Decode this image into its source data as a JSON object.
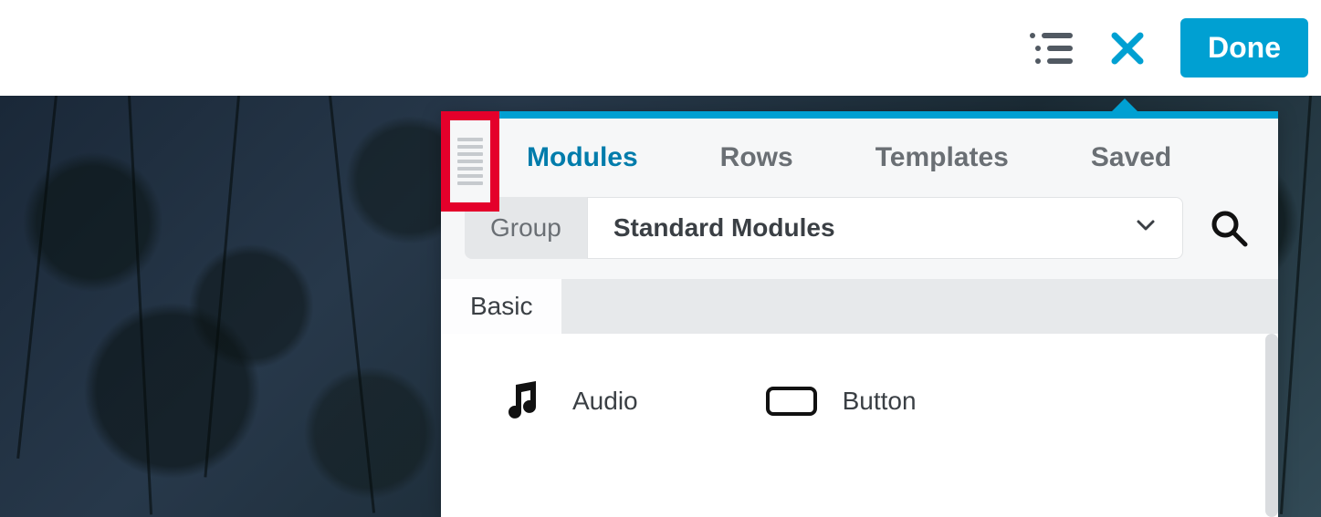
{
  "colors": {
    "accent": "#00A0D2",
    "highlight_box": "#e4002b"
  },
  "topbar": {
    "done_label": "Done"
  },
  "panel": {
    "tabs": [
      {
        "label": "Modules",
        "active": true
      },
      {
        "label": "Rows",
        "active": false
      },
      {
        "label": "Templates",
        "active": false
      },
      {
        "label": "Saved",
        "active": false
      }
    ],
    "group": {
      "label": "Group",
      "selected": "Standard Modules"
    },
    "section": {
      "label": "Basic"
    },
    "modules": [
      {
        "icon": "audio",
        "label": "Audio"
      },
      {
        "icon": "button",
        "label": "Button"
      }
    ]
  }
}
